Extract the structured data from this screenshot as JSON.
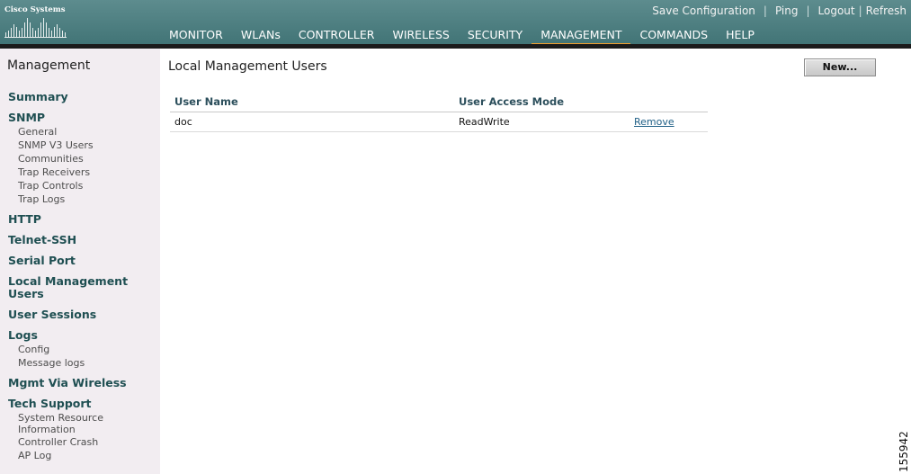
{
  "header": {
    "logo_text": "Cisco Systems",
    "util_links": [
      "Save Configuration",
      "Ping",
      "Logout",
      "Refresh"
    ],
    "nav": [
      "MONITOR",
      "WLANs",
      "CONTROLLER",
      "WIRELESS",
      "SECURITY",
      "MANAGEMENT",
      "COMMANDS",
      "HELP"
    ],
    "active_nav": "MANAGEMENT"
  },
  "sidebar": {
    "title": "Management",
    "summary": "Summary",
    "snmp": {
      "label": "SNMP",
      "items": [
        "General",
        "SNMP V3 Users",
        "Communities",
        "Trap Receivers",
        "Trap Controls",
        "Trap Logs"
      ]
    },
    "http": "HTTP",
    "telnet_ssh": "Telnet-SSH",
    "serial_port": "Serial Port",
    "local_mgmt_users": "Local Management Users",
    "user_sessions": "User Sessions",
    "logs": {
      "label": "Logs",
      "items": [
        "Config",
        "Message logs"
      ]
    },
    "mgmt_via_wireless": "Mgmt Via Wireless",
    "tech_support": {
      "label": "Tech Support",
      "items": [
        "System Resource Information",
        "Controller Crash",
        "AP Log"
      ]
    }
  },
  "main": {
    "title": "Local Management Users",
    "new_button": "New...",
    "table": {
      "headers": [
        "User Name",
        "User Access Mode"
      ],
      "rows": [
        {
          "user_name": "doc",
          "access_mode": "ReadWrite",
          "action": "Remove"
        }
      ]
    }
  },
  "figure_id": "155942",
  "colors": {
    "header_teal": "#4a7c7e",
    "header_bar": "#1b1b1b",
    "active_underline": "#f0a030",
    "sidebar_bg": "#f2edf1",
    "sidebar_heading": "#1f4f52",
    "link": "#1f5f86"
  }
}
